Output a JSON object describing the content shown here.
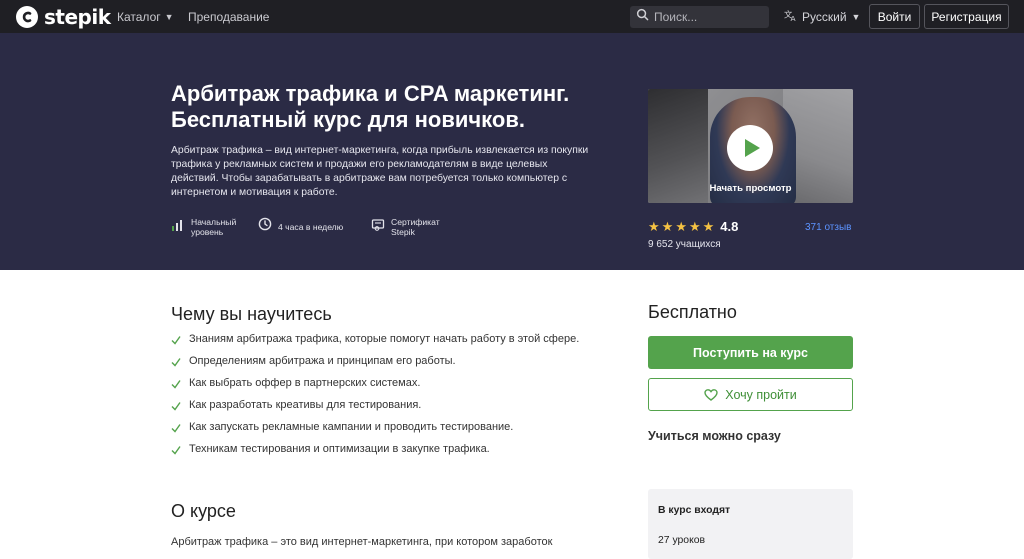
{
  "nav": {
    "brand": "stepik",
    "catalog": "Каталог",
    "teaching": "Преподавание",
    "search_placeholder": "Поиск...",
    "language": "Русский",
    "login": "Войти",
    "register": "Регистрация"
  },
  "hero": {
    "title": "Арбитраж трафика и CPA маркетинг. Бесплатный курс для новичков.",
    "description": "Арбитраж трафика – вид интернет-маркетинга, когда прибыль извлекается из покупки трафика у рекламных систем и продажи его рекламодателям в виде целевых действий. Чтобы зарабатывать в арбитраже вам потребуется только компьютер с интернетом и мотивация к работе.",
    "meta": {
      "level": [
        "Начальный",
        "уровень"
      ],
      "hours": "4 часа в неделю",
      "certificate": [
        "Сертификат",
        "Stepik"
      ]
    },
    "video_label": "Начать просмотр",
    "rating": "4.8",
    "stars": 5,
    "reviews": "371 отзыв",
    "students": "9 652 учащихся"
  },
  "learn": {
    "title": "Чему вы научитесь",
    "items": [
      "Знаниям арбитража трафика, которые помогут начать работу в этой сфере.",
      "Определениям арбитража и принципам его работы.",
      "Как выбрать оффер в партнерских системах.",
      "Как разработать креативы для тестирования.",
      "Как запускать рекламные кампании и проводить тестирование.",
      "Техникам тестирования и оптимизации в закупке трафика."
    ]
  },
  "about": {
    "title": "О курсе",
    "text": "Арбитраж трафика – это вид интернет-маркетинга, при котором заработок"
  },
  "sidebar": {
    "price": "Бесплатно",
    "enroll": "Поступить на курс",
    "wishlist": "Хочу пройти",
    "start_now": "Учиться можно сразу",
    "includes_title": "В курс входят",
    "lessons": "27 уроков"
  },
  "colors": {
    "nav_bg": "#1f1f24",
    "hero_bg": "#2b2b45",
    "accent_green": "#54a34c",
    "star": "#f5c243",
    "link": "#5c93ff"
  }
}
